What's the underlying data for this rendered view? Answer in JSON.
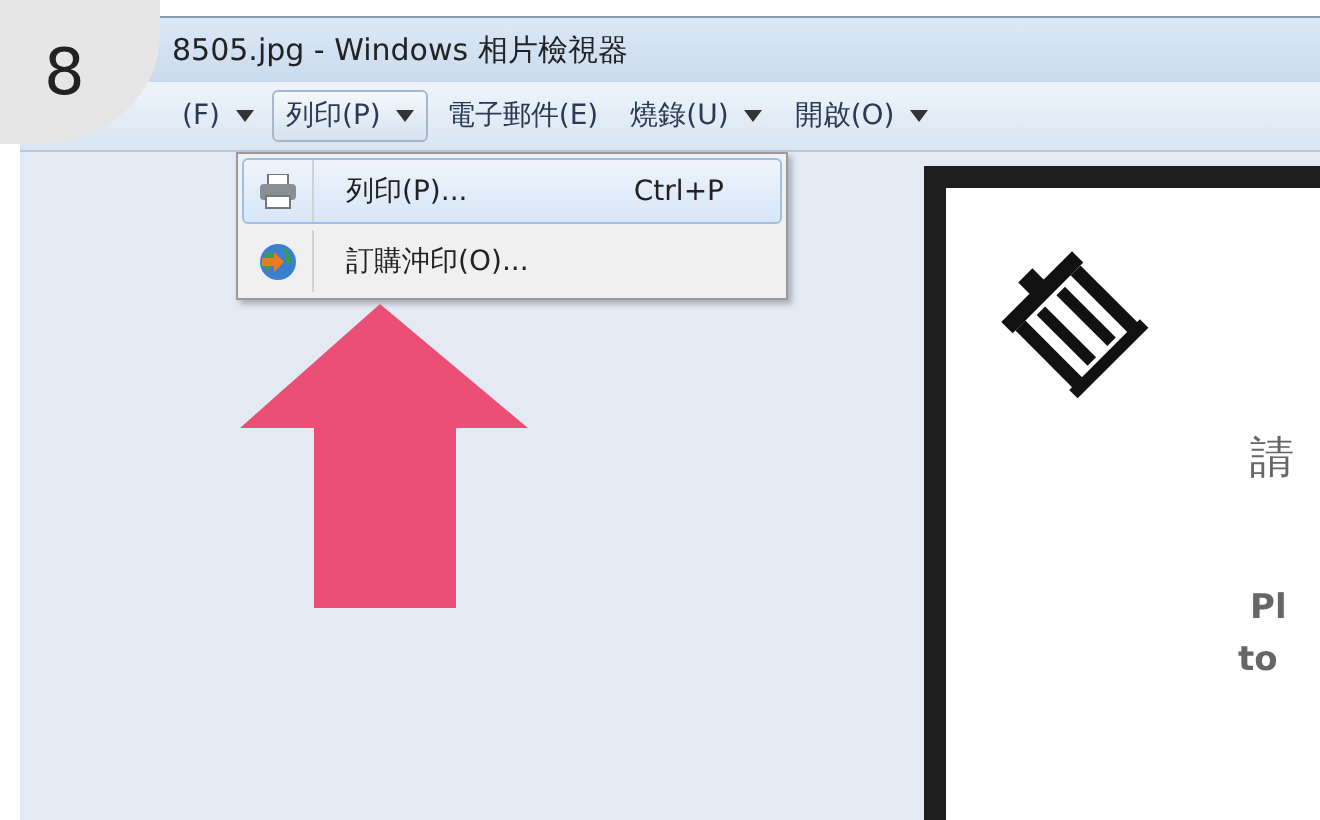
{
  "step_badge": "8",
  "window": {
    "title": "8505.jpg - Windows 相片檢視器"
  },
  "menu_bar": [
    {
      "label": "(F)",
      "has_dropdown": true,
      "selected": false
    },
    {
      "label": "列印(P)",
      "has_dropdown": true,
      "selected": true
    },
    {
      "label": "電子郵件(E)",
      "has_dropdown": false,
      "selected": false
    },
    {
      "label": "燒錄(U)",
      "has_dropdown": true,
      "selected": false
    },
    {
      "label": "開啟(O)",
      "has_dropdown": true,
      "selected": false
    }
  ],
  "dropdown": [
    {
      "kind": "printer",
      "label": "列印(P)...",
      "shortcut": "Ctrl+P",
      "selected": true
    },
    {
      "kind": "globe",
      "label": "訂購沖印(O)...",
      "selected": false
    }
  ],
  "document": {
    "heading": "請",
    "line_1": "Pl",
    "line_2": "to"
  }
}
